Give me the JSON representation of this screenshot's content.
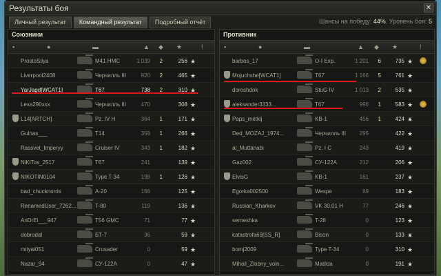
{
  "window": {
    "title": "Результаты боя",
    "close_icon": "close-icon"
  },
  "tabs": [
    "Личный результат",
    "Командный результат",
    "Подробный отчёт"
  ],
  "active_tab": 1,
  "win_chance": {
    "label": "Шансы на победу:",
    "value": "44%",
    "level_label": "Уровень боя:",
    "level": "5"
  },
  "allies": {
    "title": "Союзники",
    "rows": [
      {
        "name": "ProstoSilya",
        "vehicle": "M41 HMC",
        "damage": "1 039",
        "frags": "2",
        "xp": "256",
        "clan": false,
        "medal": false
      },
      {
        "name": "Liverpool2408",
        "vehicle": "Черчилль III",
        "damage": "820",
        "frags": "2",
        "xp": "465",
        "clan": false,
        "medal": false
      },
      {
        "name": "YarJagd[WCAT1]",
        "vehicle": "T67",
        "damage": "738",
        "frags": "2",
        "xp": "310",
        "clan": false,
        "medal": false,
        "me": true
      },
      {
        "name": "Lexa290xxx",
        "vehicle": "Черчилль III",
        "damage": "470",
        "frags": "",
        "xp": "308",
        "clan": false,
        "medal": false
      },
      {
        "name": "L14[ARTCH]",
        "vehicle": "Pz. IV H",
        "damage": "364",
        "frags": "1",
        "xp": "171",
        "clan": true,
        "medal": false
      },
      {
        "name": "Gulnas___",
        "vehicle": "T14",
        "damage": "359",
        "frags": "1",
        "xp": "266",
        "clan": false,
        "medal": false
      },
      {
        "name": "Rassvet_Imperyy",
        "vehicle": "Cruiser IV",
        "damage": "343",
        "frags": "1",
        "xp": "182",
        "clan": false,
        "medal": false
      },
      {
        "name": "NiKiTos_2517",
        "vehicle": "T67",
        "damage": "241",
        "frags": "",
        "xp": "139",
        "clan": true,
        "medal": false
      },
      {
        "name": "NIKOTIN0104",
        "vehicle": "Type T-34",
        "damage": "198",
        "frags": "1",
        "xp": "126",
        "clan": true,
        "medal": false
      },
      {
        "name": "bad_chucknorris",
        "vehicle": "A-20",
        "damage": "166",
        "frags": "",
        "xp": "125",
        "clan": false,
        "medal": false
      },
      {
        "name": "RenamedUser_7262...",
        "vehicle": "T-80",
        "damage": "119",
        "frags": "",
        "xp": "136",
        "clan": false,
        "medal": false
      },
      {
        "name": "AnDrEi___947",
        "vehicle": "T56 GMC",
        "damage": "71",
        "frags": "",
        "xp": "77",
        "clan": false,
        "medal": false
      },
      {
        "name": "dobrodal",
        "vehicle": "БТ-7",
        "damage": "36",
        "frags": "",
        "xp": "59",
        "clan": false,
        "medal": false
      },
      {
        "name": "mityai051",
        "vehicle": "Crusader",
        "damage": "0",
        "frags": "",
        "xp": "59",
        "clan": false,
        "medal": false
      },
      {
        "name": "Nazar_94",
        "vehicle": "СУ-122А",
        "damage": "0",
        "frags": "",
        "xp": "47",
        "clan": false,
        "medal": false
      }
    ]
  },
  "enemies": {
    "title": "Противник",
    "rows": [
      {
        "name": "barbos_17",
        "vehicle": "O-I Exp.",
        "damage": "1 201",
        "frags": "6",
        "xp": "735",
        "clan": false,
        "medal": true
      },
      {
        "name": "Mojuchshe[WCAT1]",
        "vehicle": "T67",
        "damage": "1 166",
        "frags": "5",
        "xp": "761",
        "clan": true,
        "medal": false
      },
      {
        "name": "doroshdok",
        "vehicle": "StuG IV",
        "damage": "1 013",
        "frags": "2",
        "xp": "535",
        "clan": false,
        "medal": false
      },
      {
        "name": "aleksander3333...",
        "vehicle": "T67",
        "damage": "996",
        "frags": "1",
        "xp": "583",
        "clan": true,
        "medal": true
      },
      {
        "name": "Paps_metkij",
        "vehicle": "KB-1",
        "damage": "456",
        "frags": "1",
        "xp": "424",
        "clan": true,
        "medal": false
      },
      {
        "name": "Ded_MOZAJ_1974...",
        "vehicle": "Черчилль III",
        "damage": "295",
        "frags": "",
        "xp": "422",
        "clan": false,
        "medal": false
      },
      {
        "name": "al_Muttanabi",
        "vehicle": "Pz. I C",
        "damage": "243",
        "frags": "",
        "xp": "419",
        "clan": false,
        "medal": false
      },
      {
        "name": "Gaz002",
        "vehicle": "СУ-122А",
        "damage": "212",
        "frags": "",
        "xp": "206",
        "clan": false,
        "medal": false
      },
      {
        "name": "ElvisG",
        "vehicle": "KB-1",
        "damage": "161",
        "frags": "",
        "xp": "237",
        "clan": true,
        "medal": false
      },
      {
        "name": "Egorka002500",
        "vehicle": "Wespe",
        "damage": "89",
        "frags": "",
        "xp": "183",
        "clan": false,
        "medal": false
      },
      {
        "name": "Russian_Kharkov",
        "vehicle": "VK 30.01 H",
        "damage": "77",
        "frags": "",
        "xp": "246",
        "clan": false,
        "medal": false
      },
      {
        "name": "serneshka",
        "vehicle": "T-28",
        "damage": "0",
        "frags": "",
        "xp": "123",
        "clan": false,
        "medal": false
      },
      {
        "name": "katastrofa69[SS_R]",
        "vehicle": "Bison",
        "damage": "0",
        "frags": "",
        "xp": "133",
        "clan": false,
        "medal": false
      },
      {
        "name": "bomj2009",
        "vehicle": "Type T-34",
        "damage": "0",
        "frags": "",
        "xp": "310",
        "clan": false,
        "medal": false
      },
      {
        "name": "Mihail_Zlobny_voin...",
        "vehicle": "Matilda",
        "damage": "0",
        "frags": "",
        "xp": "191",
        "clan": false,
        "medal": false
      }
    ]
  },
  "colors": {
    "marker": "#e0141c",
    "frags": "#dede9e",
    "accent": "#f0c14a"
  }
}
